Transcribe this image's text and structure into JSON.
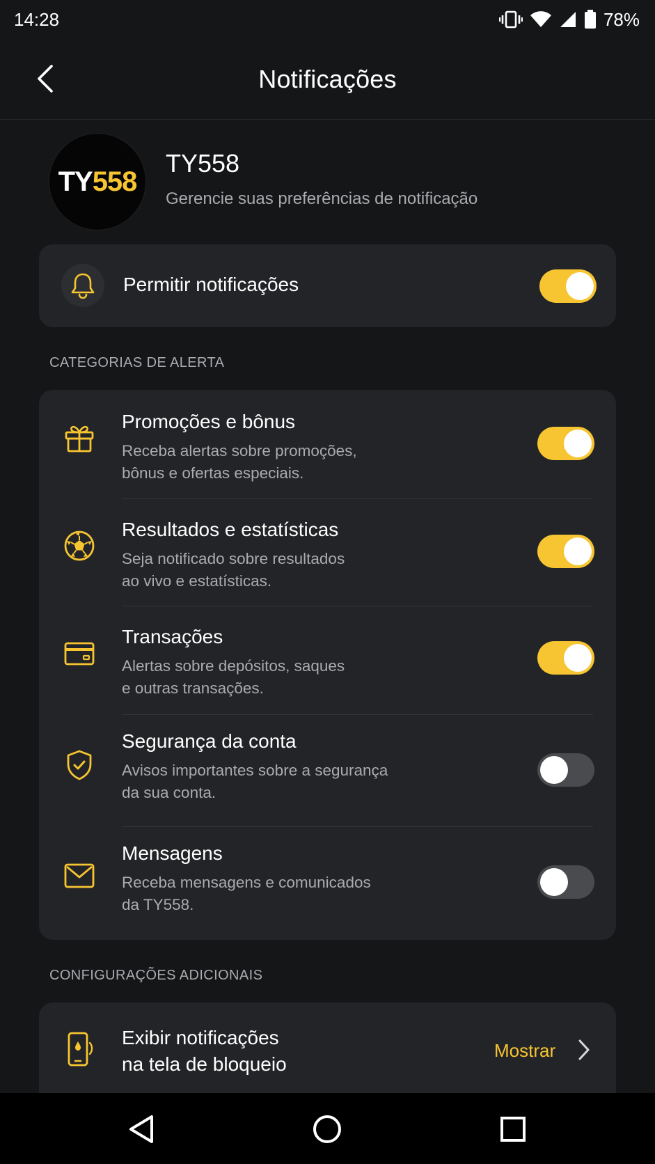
{
  "status_bar": {
    "time": "14:28",
    "battery": "78%",
    "icons": [
      "vibrate-icon",
      "wifi-icon",
      "signal-icon",
      "battery-icon"
    ]
  },
  "header": {
    "title": "Notificações",
    "back_icon": "chevron-left-icon"
  },
  "brand": {
    "logo_prefix": "TY",
    "logo_number": "558",
    "name": "TY558",
    "subtitle": "Gerencie suas preferências de notificação"
  },
  "allow": {
    "label": "Permitir notificações",
    "icon": "bell-icon",
    "enabled": true
  },
  "categories": {
    "section_title": "CATEGORIAS DE ALERTA",
    "items": [
      {
        "title": "Promoções e bônus",
        "desc_line1": "Receba alertas sobre promoções,",
        "desc_line2": "bônus e ofertas especiais.",
        "icon": "gift-icon",
        "enabled": true
      },
      {
        "title": "Resultados e estatísticas",
        "desc_line1": "Seja notificado sobre resultados",
        "desc_line2": "ao vivo e estatísticas.",
        "icon": "soccer-ball-icon",
        "enabled": true
      },
      {
        "title": "Transações",
        "desc_line1": "Alertas sobre depósitos, saques",
        "desc_line2": "e outras transações.",
        "icon": "credit-card-icon",
        "enabled": true
      },
      {
        "title": "Segurança da conta",
        "desc_line1": "Avisos importantes sobre a segurança",
        "desc_line2": "da sua conta.",
        "icon": "shield-check-icon",
        "enabled": false
      },
      {
        "title": "Mensagens",
        "desc_line1": "Receba mensagens e comunicados",
        "desc_line2": "da TY558.",
        "icon": "envelope-icon",
        "enabled": false
      }
    ]
  },
  "additional": {
    "section_title": "CONFIGURAÇÕES ADICIONAIS",
    "lockscreen": {
      "title_line1": "Exibir notificações",
      "title_line2": "na tela de bloqueio",
      "value": "Mostrar",
      "icon": "phone-lock-icon"
    }
  },
  "nav": {
    "back": "nav-back-icon",
    "home": "nav-home-icon",
    "recents": "nav-recents-icon"
  },
  "colors": {
    "accent": "#f7c531",
    "background": "#151618",
    "card": "#232427",
    "text_secondary": "#a9abaf",
    "toggle_off": "#4a4b4e"
  }
}
